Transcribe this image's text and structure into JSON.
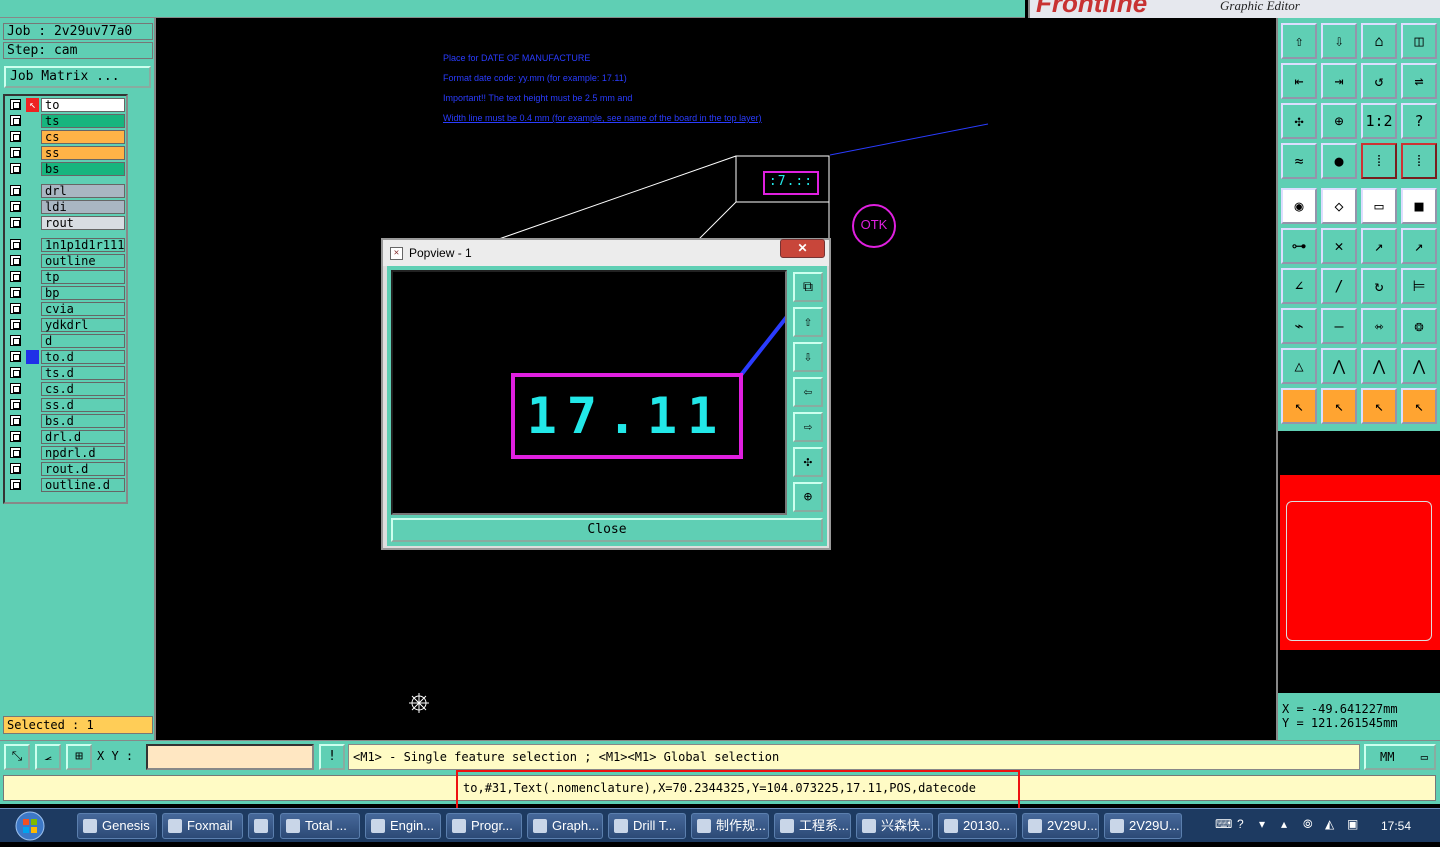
{
  "app": {
    "brand_logo": "Frontline",
    "brand_subtitle": "Graphic Editor"
  },
  "left_panel": {
    "job_label": "Job : 2v29uv77a0",
    "step_label": "Step: cam",
    "job_matrix_button": "Job Matrix ...",
    "selected_label": "Selected : 1",
    "layers": [
      {
        "name": "to",
        "color": "#ffffff",
        "active": true
      },
      {
        "name": "ts",
        "color": "#17b57e"
      },
      {
        "name": "cs",
        "color": "#ffb347"
      },
      {
        "name": "ss",
        "color": "#ffb347"
      },
      {
        "name": "bs",
        "color": "#17b57e"
      },
      {
        "name": "drl",
        "color": "#a9b6c2"
      },
      {
        "name": "ldi",
        "color": "#a9b6c2"
      },
      {
        "name": "rout",
        "color": "#d8dde2"
      },
      {
        "name": "1n1p1d1r111",
        "color": "#5fcfb4"
      },
      {
        "name": "outline",
        "color": "#5fcfb4"
      },
      {
        "name": "tp",
        "color": "#5fcfb4"
      },
      {
        "name": "bp",
        "color": "#5fcfb4"
      },
      {
        "name": "cvia",
        "color": "#5fcfb4"
      },
      {
        "name": "ydkdrl",
        "color": "#5fcfb4"
      },
      {
        "name": "d",
        "color": "#5fcfb4"
      },
      {
        "name": "to.d",
        "color": "#5fcfb4",
        "marked": true
      },
      {
        "name": "ts.d",
        "color": "#5fcfb4"
      },
      {
        "name": "cs.d",
        "color": "#5fcfb4"
      },
      {
        "name": "ss.d",
        "color": "#5fcfb4"
      },
      {
        "name": "bs.d",
        "color": "#5fcfb4"
      },
      {
        "name": "drl.d",
        "color": "#5fcfb4"
      },
      {
        "name": "npdrl.d",
        "color": "#5fcfb4"
      },
      {
        "name": "rout.d",
        "color": "#5fcfb4"
      },
      {
        "name": "outline.d",
        "color": "#5fcfb4"
      }
    ]
  },
  "canvas": {
    "notes": [
      "Place for DATE OF MANUFACTURE",
      "Format date code: yy.mm (for example: 17.11)",
      "Important!! The text height must be 2.5 mm and",
      "Width line must be 0.4 mm (for example, see name of the board in the top layer)"
    ],
    "small_date_text": ":7.::",
    "otk_label": "OTK"
  },
  "popview": {
    "title": "Popview - 1",
    "date_text": "17.11",
    "close_label": "Close",
    "tools": [
      "zoom-home-icon",
      "zoom-up-icon",
      "zoom-down-icon",
      "zoom-left-icon",
      "zoom-right-icon",
      "zoom-in-icon",
      "zoom-out-icon"
    ]
  },
  "right_panel": {
    "coord_x": "X = -49.641227mm",
    "coord_y": "Y = 121.261545mm",
    "tool_rows": [
      [
        "⇧",
        "⇩",
        "⌂",
        "◫"
      ],
      [
        "⇤",
        "⇥",
        "↺",
        "⇌"
      ],
      [
        "✣",
        "⊕",
        "1:2",
        "?"
      ],
      [
        "≈",
        "●",
        "⁞",
        "⁞"
      ],
      [
        "◉",
        "◇",
        "▭",
        "■"
      ],
      [
        "⊶",
        "✕",
        "↗",
        "↗"
      ],
      [
        "∠",
        "/",
        "↻",
        "⊨"
      ],
      [
        "⌁",
        "—",
        "⇿",
        "❂"
      ],
      [
        "△",
        "⋀",
        "⋀",
        "⋀"
      ],
      [
        "↖",
        "↖",
        "↖",
        "↖"
      ]
    ]
  },
  "bottom": {
    "xy_label": "X Y :",
    "xy_value": "",
    "message": "<M1> - Single feature selection ; <M1><M1> Global selection",
    "units": "MM",
    "status": "to,#31,Text(.nomenclature),X=70.2344325,Y=104.073225,17.11,POS,datecode"
  },
  "taskbar": {
    "items": [
      "Genesis",
      "Foxmail",
      "",
      "Total ...",
      "Engin...",
      "Progr...",
      "Graph...",
      "Drill T...",
      "制作规...",
      "工程系...",
      "兴森快...",
      "20130...",
      "2V29U...",
      "2V29U..."
    ],
    "clock": "17:54"
  }
}
